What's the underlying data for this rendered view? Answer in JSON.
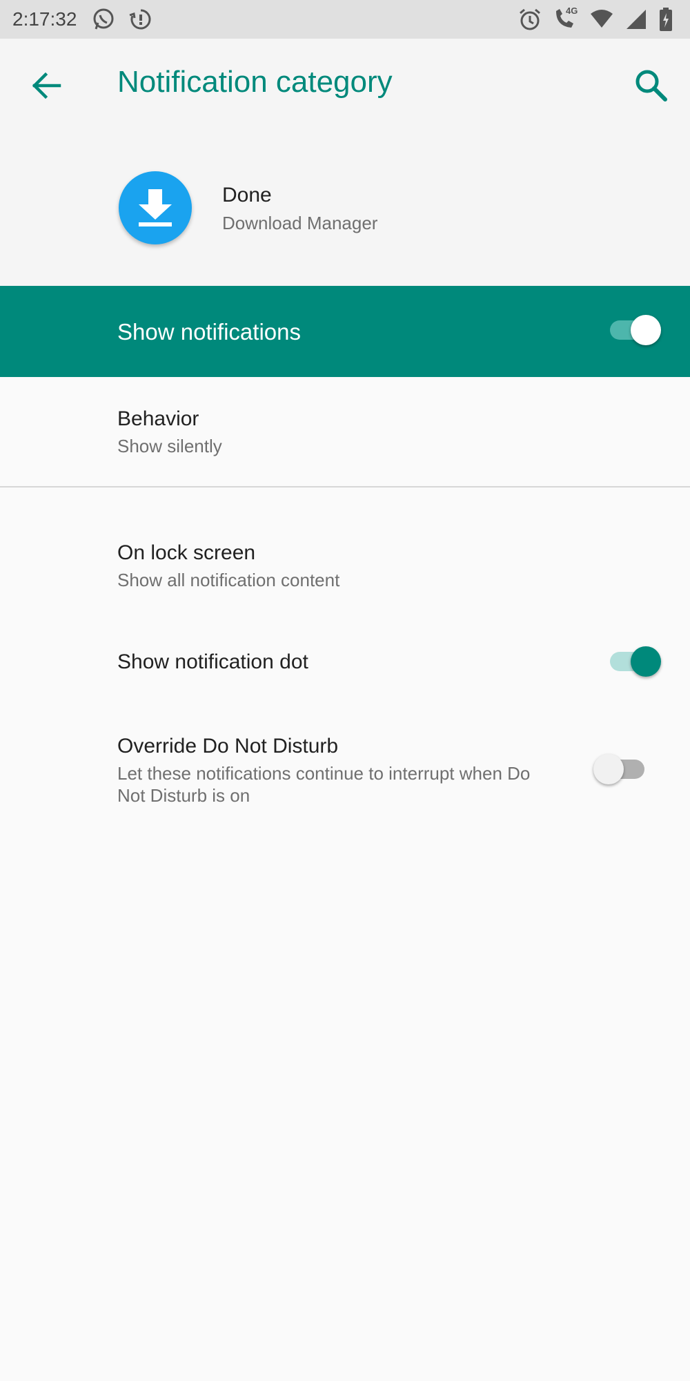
{
  "status_bar": {
    "time": "2:17:32",
    "left_icons": [
      "whatsapp-icon",
      "sync-alert-icon"
    ],
    "right_icons": [
      "alarm-icon",
      "volte-call-icon",
      "wifi-icon",
      "signal-icon",
      "battery-charging-icon"
    ],
    "network_label": "4G"
  },
  "app_bar": {
    "title": "Notification category",
    "back_icon": "arrow-back-icon",
    "search_icon": "search-icon",
    "accent_color": "#00897b"
  },
  "app_header": {
    "name": "Done",
    "subtitle": "Download Manager",
    "icon": "download-icon",
    "icon_color": "#1aa3ef"
  },
  "master": {
    "label": "Show notifications",
    "enabled": true
  },
  "prefs": {
    "behavior": {
      "title": "Behavior",
      "summary": "Show silently"
    },
    "lock_screen": {
      "title": "On lock screen",
      "summary": "Show all notification content"
    },
    "notification_dot": {
      "title": "Show notification dot",
      "enabled": true
    },
    "override_dnd": {
      "title": "Override Do Not Disturb",
      "summary": "Let these notifications continue to interrupt when Do Not Disturb is on",
      "enabled": false
    }
  }
}
